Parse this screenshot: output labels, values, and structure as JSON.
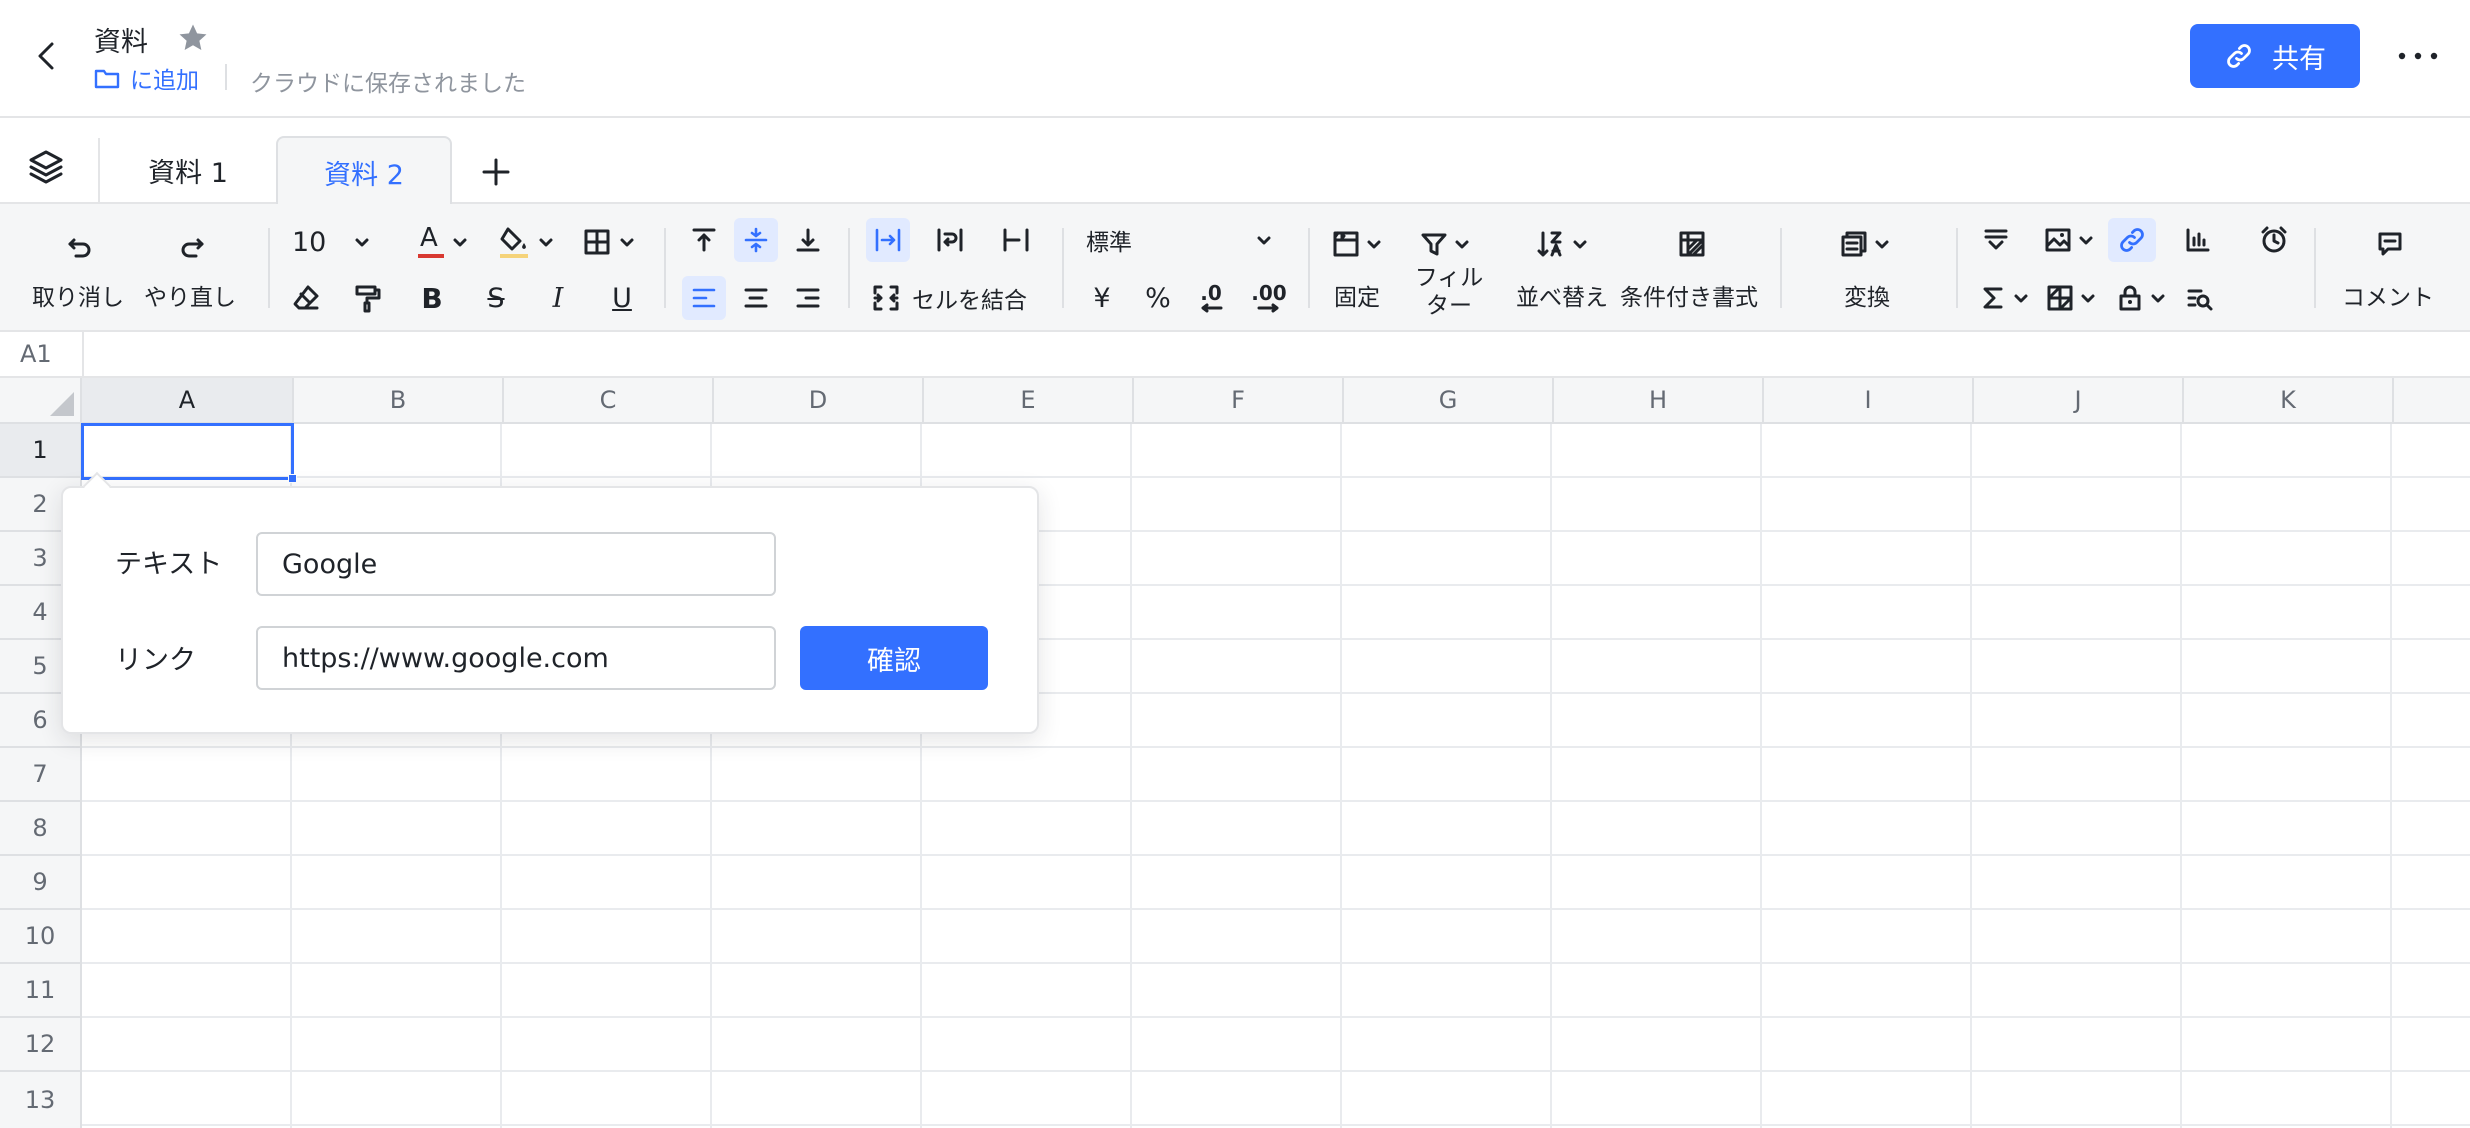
{
  "header": {
    "title": "資料",
    "folder_link": "に追加",
    "save_status": "クラウドに保存されました",
    "share_label": "共有"
  },
  "tabs": [
    {
      "label": "資料 1",
      "active": false
    },
    {
      "label": "資料 2",
      "active": true
    }
  ],
  "toolbar": {
    "undo_label": "取り消し",
    "redo_label": "やり直し",
    "font_size": "10",
    "merge_label": "セルを結合",
    "number_format": "標準",
    "currency_symbol": "¥",
    "percent_symbol": "%",
    "decimal_decrease": ".0",
    "decimal_increase": ".00",
    "freeze_label": "固定",
    "filter_label": "フィルター",
    "sort_label": "並べ替え",
    "conditional_label": "条件付き書式",
    "convert_label": "変換",
    "comment_label": "コメント",
    "bold_glyph": "B",
    "italic_glyph": "I",
    "underline_glyph": "U",
    "strike_glyph": "S",
    "font_color_glyph": "A",
    "font_color": "#d83931"
  },
  "formula_bar": {
    "cell_ref": "A1"
  },
  "grid": {
    "columns": [
      "A",
      "B",
      "C",
      "D",
      "E",
      "F",
      "G",
      "H",
      "I",
      "J",
      "K"
    ],
    "rows": [
      "1",
      "2",
      "3",
      "4",
      "5",
      "6",
      "7",
      "8",
      "9",
      "10",
      "11",
      "12",
      "13"
    ],
    "selected_column": "A",
    "selected_row": "1"
  },
  "link_popover": {
    "text_label": "テキスト",
    "text_value": "Google",
    "link_label": "リンク",
    "link_value": "https://www.google.com",
    "confirm_label": "確認"
  },
  "colors": {
    "accent": "#3370ff",
    "toolbar_bg": "#f5f6f7",
    "active_tool_bg": "#e1eaff"
  }
}
